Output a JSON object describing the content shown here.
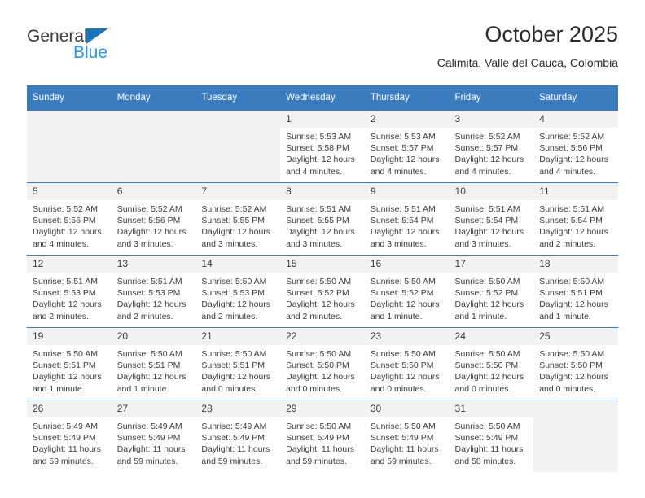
{
  "brand": {
    "name_top": "General",
    "name_bottom": "Blue",
    "accent_color": "#1b75bb",
    "accent_color_light": "#2e97e0"
  },
  "header": {
    "title": "October 2025",
    "subtitle": "Calimita, Valle del Cauca, Colombia"
  },
  "theme": {
    "header_row_bg": "#3b7cbf",
    "cell_header_bg": "#f2f2f2",
    "text_color": "#3b3b3b"
  },
  "weekday_headers": [
    "Sunday",
    "Monday",
    "Tuesday",
    "Wednesday",
    "Thursday",
    "Friday",
    "Saturday"
  ],
  "weeks": [
    [
      {
        "day": "",
        "empty": true
      },
      {
        "day": "",
        "empty": true
      },
      {
        "day": "",
        "empty": true
      },
      {
        "day": "1",
        "sunrise": "Sunrise: 5:53 AM",
        "sunset": "Sunset: 5:58 PM",
        "daylight_line1": "Daylight: 12 hours",
        "daylight_line2": "and 4 minutes."
      },
      {
        "day": "2",
        "sunrise": "Sunrise: 5:53 AM",
        "sunset": "Sunset: 5:57 PM",
        "daylight_line1": "Daylight: 12 hours",
        "daylight_line2": "and 4 minutes."
      },
      {
        "day": "3",
        "sunrise": "Sunrise: 5:52 AM",
        "sunset": "Sunset: 5:57 PM",
        "daylight_line1": "Daylight: 12 hours",
        "daylight_line2": "and 4 minutes."
      },
      {
        "day": "4",
        "sunrise": "Sunrise: 5:52 AM",
        "sunset": "Sunset: 5:56 PM",
        "daylight_line1": "Daylight: 12 hours",
        "daylight_line2": "and 4 minutes."
      }
    ],
    [
      {
        "day": "5",
        "sunrise": "Sunrise: 5:52 AM",
        "sunset": "Sunset: 5:56 PM",
        "daylight_line1": "Daylight: 12 hours",
        "daylight_line2": "and 4 minutes."
      },
      {
        "day": "6",
        "sunrise": "Sunrise: 5:52 AM",
        "sunset": "Sunset: 5:56 PM",
        "daylight_line1": "Daylight: 12 hours",
        "daylight_line2": "and 3 minutes."
      },
      {
        "day": "7",
        "sunrise": "Sunrise: 5:52 AM",
        "sunset": "Sunset: 5:55 PM",
        "daylight_line1": "Daylight: 12 hours",
        "daylight_line2": "and 3 minutes."
      },
      {
        "day": "8",
        "sunrise": "Sunrise: 5:51 AM",
        "sunset": "Sunset: 5:55 PM",
        "daylight_line1": "Daylight: 12 hours",
        "daylight_line2": "and 3 minutes."
      },
      {
        "day": "9",
        "sunrise": "Sunrise: 5:51 AM",
        "sunset": "Sunset: 5:54 PM",
        "daylight_line1": "Daylight: 12 hours",
        "daylight_line2": "and 3 minutes."
      },
      {
        "day": "10",
        "sunrise": "Sunrise: 5:51 AM",
        "sunset": "Sunset: 5:54 PM",
        "daylight_line1": "Daylight: 12 hours",
        "daylight_line2": "and 3 minutes."
      },
      {
        "day": "11",
        "sunrise": "Sunrise: 5:51 AM",
        "sunset": "Sunset: 5:54 PM",
        "daylight_line1": "Daylight: 12 hours",
        "daylight_line2": "and 2 minutes."
      }
    ],
    [
      {
        "day": "12",
        "sunrise": "Sunrise: 5:51 AM",
        "sunset": "Sunset: 5:53 PM",
        "daylight_line1": "Daylight: 12 hours",
        "daylight_line2": "and 2 minutes."
      },
      {
        "day": "13",
        "sunrise": "Sunrise: 5:51 AM",
        "sunset": "Sunset: 5:53 PM",
        "daylight_line1": "Daylight: 12 hours",
        "daylight_line2": "and 2 minutes."
      },
      {
        "day": "14",
        "sunrise": "Sunrise: 5:50 AM",
        "sunset": "Sunset: 5:53 PM",
        "daylight_line1": "Daylight: 12 hours",
        "daylight_line2": "and 2 minutes."
      },
      {
        "day": "15",
        "sunrise": "Sunrise: 5:50 AM",
        "sunset": "Sunset: 5:52 PM",
        "daylight_line1": "Daylight: 12 hours",
        "daylight_line2": "and 2 minutes."
      },
      {
        "day": "16",
        "sunrise": "Sunrise: 5:50 AM",
        "sunset": "Sunset: 5:52 PM",
        "daylight_line1": "Daylight: 12 hours",
        "daylight_line2": "and 1 minute."
      },
      {
        "day": "17",
        "sunrise": "Sunrise: 5:50 AM",
        "sunset": "Sunset: 5:52 PM",
        "daylight_line1": "Daylight: 12 hours",
        "daylight_line2": "and 1 minute."
      },
      {
        "day": "18",
        "sunrise": "Sunrise: 5:50 AM",
        "sunset": "Sunset: 5:51 PM",
        "daylight_line1": "Daylight: 12 hours",
        "daylight_line2": "and 1 minute."
      }
    ],
    [
      {
        "day": "19",
        "sunrise": "Sunrise: 5:50 AM",
        "sunset": "Sunset: 5:51 PM",
        "daylight_line1": "Daylight: 12 hours",
        "daylight_line2": "and 1 minute."
      },
      {
        "day": "20",
        "sunrise": "Sunrise: 5:50 AM",
        "sunset": "Sunset: 5:51 PM",
        "daylight_line1": "Daylight: 12 hours",
        "daylight_line2": "and 1 minute."
      },
      {
        "day": "21",
        "sunrise": "Sunrise: 5:50 AM",
        "sunset": "Sunset: 5:51 PM",
        "daylight_line1": "Daylight: 12 hours",
        "daylight_line2": "and 0 minutes."
      },
      {
        "day": "22",
        "sunrise": "Sunrise: 5:50 AM",
        "sunset": "Sunset: 5:50 PM",
        "daylight_line1": "Daylight: 12 hours",
        "daylight_line2": "and 0 minutes."
      },
      {
        "day": "23",
        "sunrise": "Sunrise: 5:50 AM",
        "sunset": "Sunset: 5:50 PM",
        "daylight_line1": "Daylight: 12 hours",
        "daylight_line2": "and 0 minutes."
      },
      {
        "day": "24",
        "sunrise": "Sunrise: 5:50 AM",
        "sunset": "Sunset: 5:50 PM",
        "daylight_line1": "Daylight: 12 hours",
        "daylight_line2": "and 0 minutes."
      },
      {
        "day": "25",
        "sunrise": "Sunrise: 5:50 AM",
        "sunset": "Sunset: 5:50 PM",
        "daylight_line1": "Daylight: 12 hours",
        "daylight_line2": "and 0 minutes."
      }
    ],
    [
      {
        "day": "26",
        "sunrise": "Sunrise: 5:49 AM",
        "sunset": "Sunset: 5:49 PM",
        "daylight_line1": "Daylight: 11 hours",
        "daylight_line2": "and 59 minutes."
      },
      {
        "day": "27",
        "sunrise": "Sunrise: 5:49 AM",
        "sunset": "Sunset: 5:49 PM",
        "daylight_line1": "Daylight: 11 hours",
        "daylight_line2": "and 59 minutes."
      },
      {
        "day": "28",
        "sunrise": "Sunrise: 5:49 AM",
        "sunset": "Sunset: 5:49 PM",
        "daylight_line1": "Daylight: 11 hours",
        "daylight_line2": "and 59 minutes."
      },
      {
        "day": "29",
        "sunrise": "Sunrise: 5:50 AM",
        "sunset": "Sunset: 5:49 PM",
        "daylight_line1": "Daylight: 11 hours",
        "daylight_line2": "and 59 minutes."
      },
      {
        "day": "30",
        "sunrise": "Sunrise: 5:50 AM",
        "sunset": "Sunset: 5:49 PM",
        "daylight_line1": "Daylight: 11 hours",
        "daylight_line2": "and 59 minutes."
      },
      {
        "day": "31",
        "sunrise": "Sunrise: 5:50 AM",
        "sunset": "Sunset: 5:49 PM",
        "daylight_line1": "Daylight: 11 hours",
        "daylight_line2": "and 58 minutes."
      },
      {
        "day": "",
        "empty": true
      }
    ]
  ]
}
